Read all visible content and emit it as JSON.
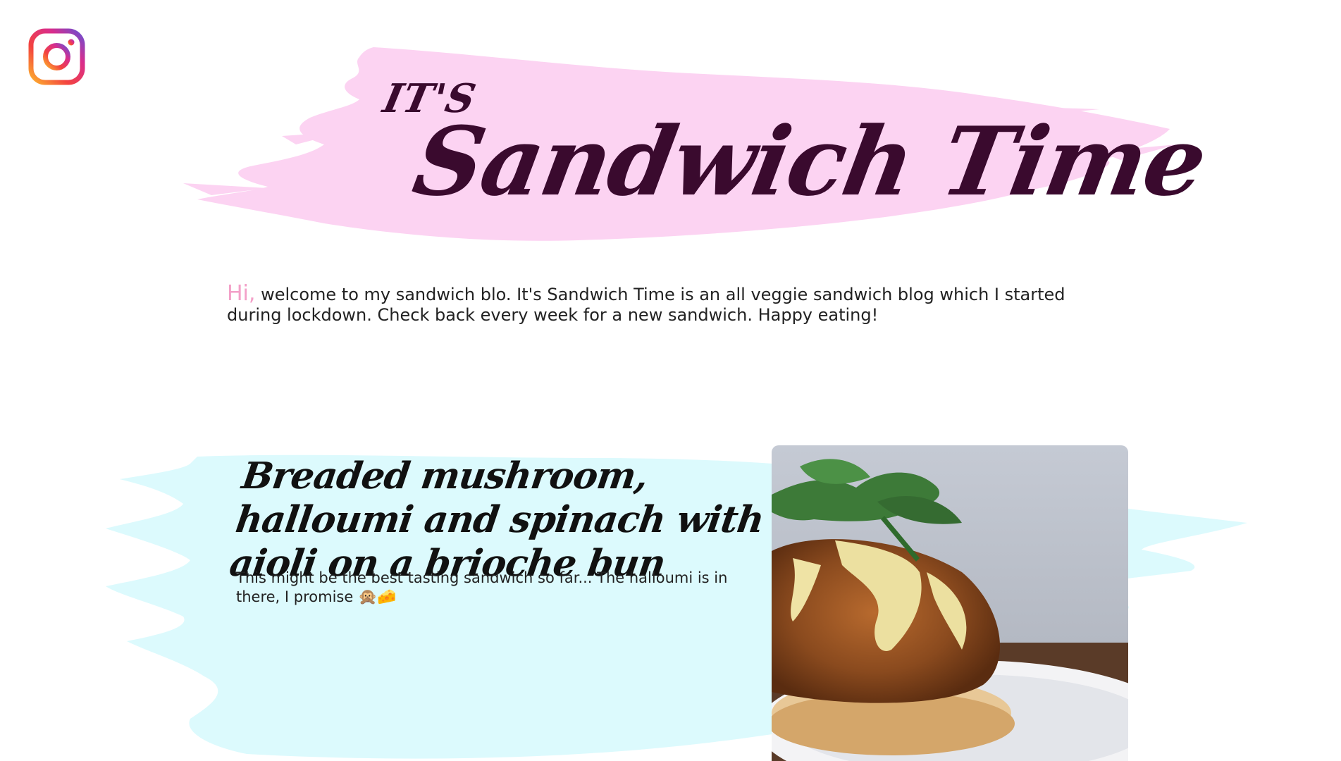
{
  "header": {
    "instagram_icon": "instagram-icon",
    "its": "IT'S",
    "title": "Sandwich Time",
    "brush_color": "#fcd3f2",
    "title_color": "#3a0a2e"
  },
  "intro": {
    "hi": "Hi,",
    "text": " welcome to my sandwich blo. It's Sandwich Time is an all veggie sandwich blog which I started during lockdown. Check back every week for a new sandwich. Happy eating!",
    "hi_color": "#f3a0c8"
  },
  "post": {
    "title": "Breaded mushroom, halloumi and spinach with aioli on a brioche bun",
    "description": "This might be the best tasting sandwich so far... The halloumi is in there, I promise",
    "emojis": "🙊🧀",
    "brush_color": "#dcfafd",
    "photo_icon": "sandwich-photo"
  }
}
